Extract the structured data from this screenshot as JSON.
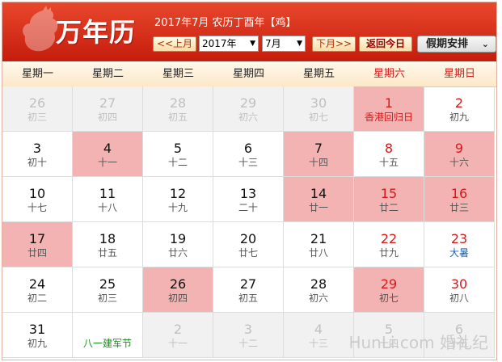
{
  "header": {
    "brand": "万年历",
    "info": "2017年7月 农历丁酉年【鸡】",
    "prev_label": "<<上月",
    "next_label": "下月>>",
    "today_label": "返回今日",
    "year_value": "2017年",
    "month_value": "7月",
    "holiday_label": "假期安排",
    "holiday_icon": "chevron-down-icon"
  },
  "weekdays": [
    "星期一",
    "星期二",
    "星期三",
    "星期四",
    "星期五",
    "星期六",
    "星期日"
  ],
  "weeks": [
    [
      {
        "day": "26",
        "lunar": "初三",
        "other": true
      },
      {
        "day": "27",
        "lunar": "初四",
        "other": true
      },
      {
        "day": "28",
        "lunar": "初五",
        "other": true
      },
      {
        "day": "29",
        "lunar": "初六",
        "other": true
      },
      {
        "day": "30",
        "lunar": "初七",
        "other": true
      },
      {
        "day": "1",
        "lunar": "香港回归日",
        "rest": true,
        "fest": "red"
      },
      {
        "day": "2",
        "lunar": "初九"
      }
    ],
    [
      {
        "day": "3",
        "lunar": "初十"
      },
      {
        "day": "4",
        "lunar": "十一",
        "rest": true
      },
      {
        "day": "5",
        "lunar": "十二"
      },
      {
        "day": "6",
        "lunar": "十三"
      },
      {
        "day": "7",
        "lunar": "十四",
        "rest": true
      },
      {
        "day": "8",
        "lunar": "十五"
      },
      {
        "day": "9",
        "lunar": "十六",
        "rest": true
      }
    ],
    [
      {
        "day": "10",
        "lunar": "十七"
      },
      {
        "day": "11",
        "lunar": "十八"
      },
      {
        "day": "12",
        "lunar": "十九"
      },
      {
        "day": "13",
        "lunar": "二十"
      },
      {
        "day": "14",
        "lunar": "廿一",
        "rest": true
      },
      {
        "day": "15",
        "lunar": "廿二",
        "rest": true
      },
      {
        "day": "16",
        "lunar": "廿三",
        "rest": true
      }
    ],
    [
      {
        "day": "17",
        "lunar": "廿四",
        "rest": true
      },
      {
        "day": "18",
        "lunar": "廿五"
      },
      {
        "day": "19",
        "lunar": "廿六"
      },
      {
        "day": "20",
        "lunar": "廿七"
      },
      {
        "day": "21",
        "lunar": "廿八"
      },
      {
        "day": "22",
        "lunar": "廿九"
      },
      {
        "day": "23",
        "lunar": "大暑",
        "term": true
      }
    ],
    [
      {
        "day": "24",
        "lunar": "初二"
      },
      {
        "day": "25",
        "lunar": "初三"
      },
      {
        "day": "26",
        "lunar": "初四",
        "rest": true
      },
      {
        "day": "27",
        "lunar": "初五"
      },
      {
        "day": "28",
        "lunar": "初六"
      },
      {
        "day": "29",
        "lunar": "初七",
        "rest": true
      },
      {
        "day": "30",
        "lunar": "初八"
      }
    ],
    [
      {
        "day": "31",
        "lunar": "初九"
      },
      {
        "day": "",
        "lunar": "八一建军节",
        "fest": "green"
      },
      {
        "day": "2",
        "lunar": "十一",
        "other": true
      },
      {
        "day": "3",
        "lunar": "十二",
        "other": true
      },
      {
        "day": "4",
        "lunar": "十三",
        "other": true
      },
      {
        "day": "5",
        "lunar": "十四",
        "other": true
      },
      {
        "day": "6",
        "lunar": "十五",
        "other": true
      }
    ]
  ],
  "watermark": "HunLi.com 婚礼纪",
  "colors": {
    "header_red": "#d3301a",
    "weekend_red": "#d41a1a",
    "rest_bg": "#f4b3b3",
    "festival_green": "#1a8a1a",
    "solar_term_blue": "#1765b8"
  }
}
